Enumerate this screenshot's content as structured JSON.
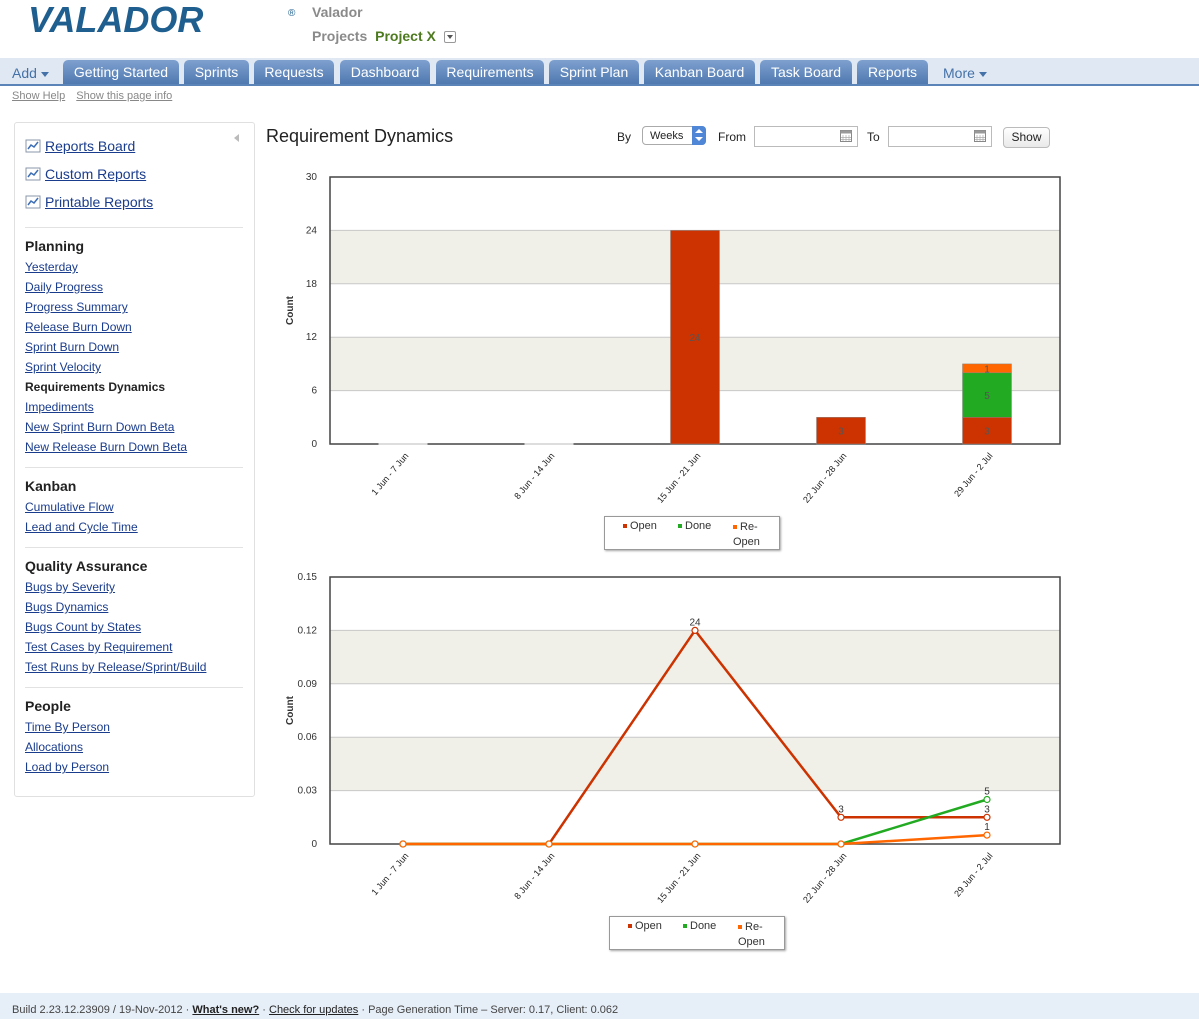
{
  "header": {
    "logo_text": "VALADOR",
    "logo_mark": "®",
    "company": "Valador",
    "projects_label": "Projects",
    "current_project": "Project X"
  },
  "nav": {
    "add_label": "Add",
    "more_label": "More",
    "tabs": [
      "Getting Started",
      "Sprints",
      "Requests",
      "Dashboard",
      "Requirements",
      "Sprint Plan",
      "Kanban Board",
      "Task Board",
      "Reports"
    ]
  },
  "help": {
    "show_help": "Show Help",
    "show_page_info": "Show this page info"
  },
  "sidebar": {
    "report_links": [
      "Reports Board",
      "Custom Reports",
      "Printable Reports"
    ],
    "sections": [
      {
        "title": "Planning",
        "items": [
          "Yesterday",
          "Daily Progress",
          "Progress Summary",
          "Release Burn Down",
          "Sprint Burn Down",
          "Sprint Velocity",
          "Requirements Dynamics",
          "Impediments",
          "New Sprint Burn Down Beta",
          "New Release Burn Down Beta"
        ],
        "current": "Requirements Dynamics"
      },
      {
        "title": "Kanban",
        "items": [
          "Cumulative Flow",
          "Lead and Cycle Time"
        ]
      },
      {
        "title": "Quality Assurance",
        "items": [
          "Bugs by Severity",
          "Bugs Dynamics",
          "Bugs Count by States",
          "Test Cases by Requirement",
          "Test Runs by Release/Sprint/Build"
        ]
      },
      {
        "title": "People",
        "items": [
          "Time By Person",
          "Allocations",
          "Load by Person"
        ]
      }
    ]
  },
  "main": {
    "title": "Requirement Dynamics",
    "by_label": "By",
    "by_value": "Weeks",
    "from_label": "From",
    "from_value": "",
    "to_label": "To",
    "to_value": "",
    "show_label": "Show"
  },
  "chart_data": [
    {
      "type": "bar",
      "stacked": true,
      "ylabel": "Count",
      "xlabel": "",
      "ylim": [
        0,
        30
      ],
      "yticks": [
        "0",
        "6",
        "12",
        "18",
        "24",
        "30"
      ],
      "categories": [
        "1 Jun - 7 Jun",
        "8 Jun - 14 Jun",
        "15 Jun - 21 Jun",
        "22 Jun - 28 Jun",
        "29 Jun - 2 Jul"
      ],
      "series": [
        {
          "name": "Open",
          "color": "#cc3300",
          "values": [
            0,
            0,
            24,
            3,
            3
          ]
        },
        {
          "name": "Done",
          "color": "#22aa22",
          "values": [
            0,
            0,
            0,
            0,
            5
          ]
        },
        {
          "name": "Re-Open",
          "color": "#ff6600",
          "values": [
            0,
            0,
            0,
            0,
            1
          ]
        }
      ],
      "legend": [
        "Open",
        "Done",
        "Re-Open"
      ],
      "grid": true
    },
    {
      "type": "line",
      "ylabel": "Count",
      "xlabel": "",
      "ylim": [
        0,
        0.15
      ],
      "yticks": [
        "0",
        "0.03",
        "0.06",
        "0.09",
        "0.12",
        "0.15"
      ],
      "categories": [
        "1 Jun - 7 Jun",
        "8 Jun - 14 Jun",
        "15 Jun - 21 Jun",
        "22 Jun - 28 Jun",
        "29 Jun - 2 Jul"
      ],
      "series": [
        {
          "name": "Open",
          "color": "#cc3300",
          "values": [
            0,
            0,
            0.12,
            0.015,
            0.015
          ],
          "labels": [
            "",
            "",
            "24",
            "3",
            "3"
          ]
        },
        {
          "name": "Done",
          "color": "#22aa22",
          "values": [
            0,
            0,
            0,
            0,
            0.025
          ],
          "labels": [
            "",
            "",
            "",
            "",
            "5"
          ]
        },
        {
          "name": "Re-Open",
          "color": "#ff6600",
          "values": [
            0,
            0,
            0,
            0,
            0.005
          ],
          "labels": [
            "",
            "",
            "",
            "",
            "1"
          ]
        }
      ],
      "legend": [
        "Open",
        "Done",
        "Re-Open"
      ],
      "grid": true
    }
  ],
  "footer": {
    "build": "Build 2.23.12.23909 / 19-Nov-2012 ·",
    "whats_new": "What's new?",
    "sep1": "·",
    "check_updates": "Check for updates",
    "gen_time": "· Page Generation Time – Server: 0.17, Client: 0.062"
  }
}
